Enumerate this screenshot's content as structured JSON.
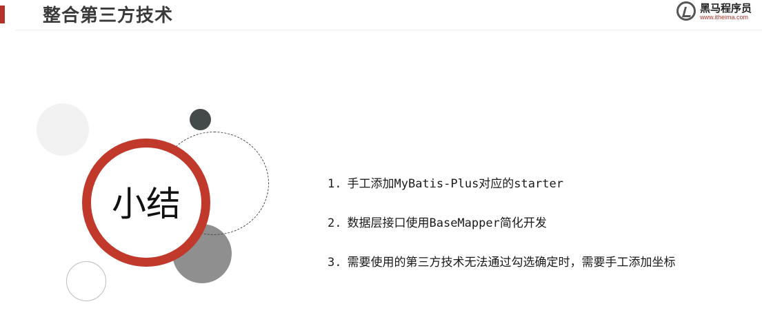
{
  "header": {
    "title": "整合第三方技术"
  },
  "logo": {
    "name": "黑马程序员",
    "url": "www.itheima.com"
  },
  "hero": {
    "label": "小结"
  },
  "summary": {
    "items": [
      {
        "num": "1.",
        "text": "手工添加MyBatis-Plus对应的starter"
      },
      {
        "num": "2.",
        "text": "数据层接口使用BaseMapper简化开发"
      },
      {
        "num": "3.",
        "text": "需要使用的第三方技术无法通过勾选确定时，需要手工添加坐标"
      }
    ]
  },
  "colors": {
    "accent": "#c0392b",
    "title": "#3a3a3a"
  }
}
